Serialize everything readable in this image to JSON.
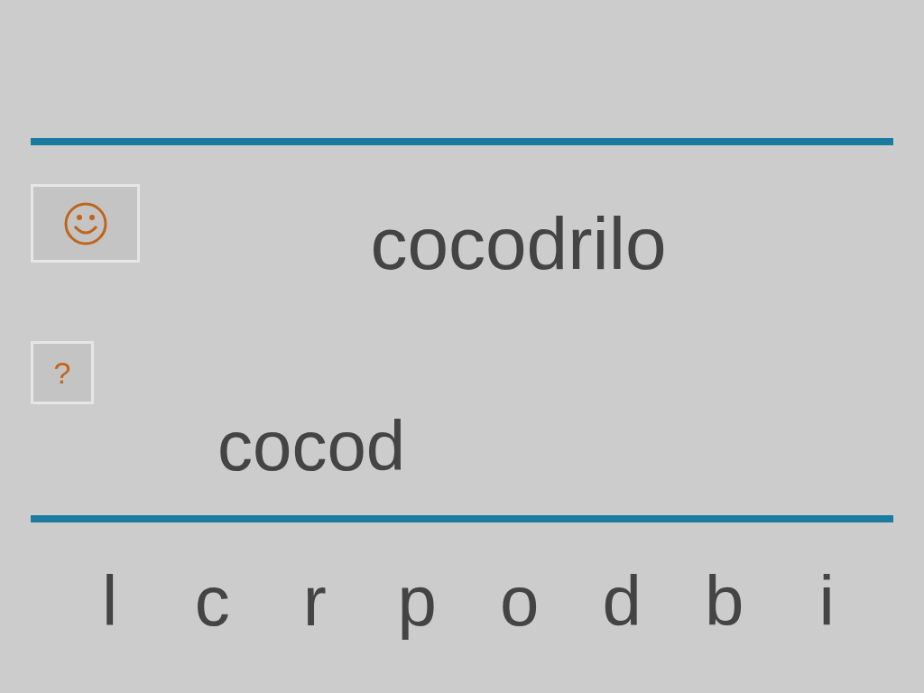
{
  "word": "cocodrilo",
  "hint_button": {
    "label": "?"
  },
  "answer": "cocod",
  "letters": [
    "l",
    "c",
    "r",
    "p",
    "o",
    "d",
    "b",
    "i"
  ]
}
